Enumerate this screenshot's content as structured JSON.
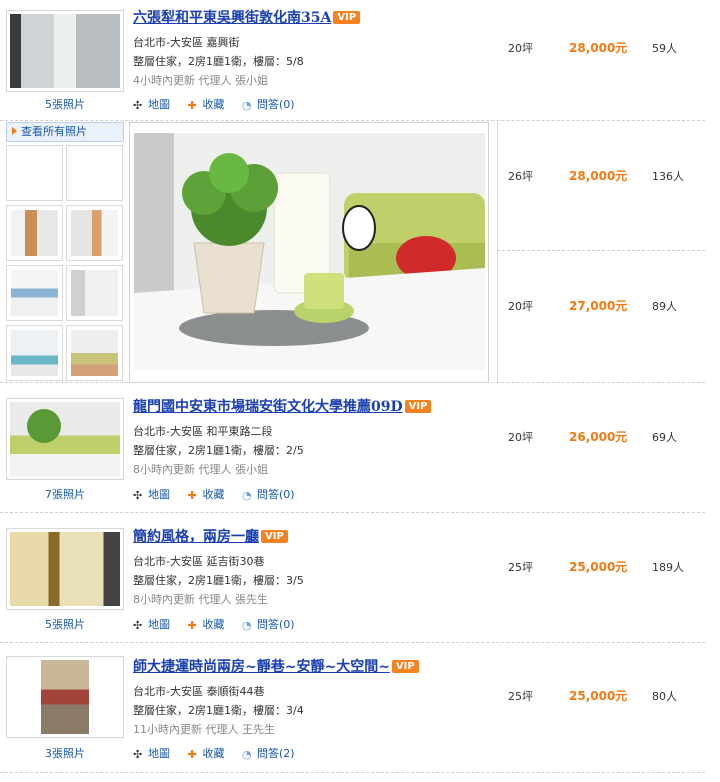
{
  "listings": [
    {
      "title": "六張犁和平東吳興街敦化南35A",
      "vip": "VIP",
      "address": "台北市-大安區 嘉興街",
      "details": "整層住家，2房1廳1衛，樓層：5/8",
      "meta": "4小時內更新  代理人 張小姐",
      "photos": "5張照片",
      "size": "20坪",
      "price": "28,000元",
      "views": "59人"
    },
    {
      "size": "26坪",
      "price": "28,000元",
      "views": "136人"
    },
    {
      "size": "20坪",
      "price": "27,000元",
      "views": "89人"
    },
    {
      "title": "龍門國中安東市場瑞安街文化大學推薦09D",
      "vip": "VIP",
      "address": "台北市-大安區 和平東路二段",
      "details": "整層住家，2房1廳1衛，樓層：2/5",
      "meta": "8小時內更新  代理人 張小姐",
      "photos": "7張照片",
      "size": "20坪",
      "price": "26,000元",
      "views": "69人"
    },
    {
      "title": "簡約風格，兩房一廳",
      "vip": "VIP",
      "address": "台北市-大安區 延吉街30巷",
      "details": "整層住家，2房1廳1衛，樓層：3/5",
      "meta": "8小時內更新  代理人 張先生",
      "photos": "5張照片",
      "size": "25坪",
      "price": "25,000元",
      "views": "189人"
    },
    {
      "title": "師大捷運時尚兩房~靜巷~安靜~大空間~",
      "vip": "VIP",
      "address": "台北市-大安區 泰順街44巷",
      "details": "整層住家，2房1廳1衛，樓層：3/4",
      "meta": "11小時內更新  代理人 王先生",
      "photos": "3張照片",
      "size": "25坪",
      "price": "25,000元",
      "views": "80人"
    }
  ],
  "actions": {
    "map": "地圖",
    "favorite": "收藏",
    "qa_0": "問答(0)",
    "qa_2": "問答(2)"
  },
  "gallery": {
    "view_all": "查看所有照片",
    "big_image_icon": "potted-plant-photo"
  },
  "colors": {
    "title_link": "#1a3fb0",
    "vip_badge": "#f58220",
    "price": "#f07a14",
    "action_link": "#1959a8"
  }
}
